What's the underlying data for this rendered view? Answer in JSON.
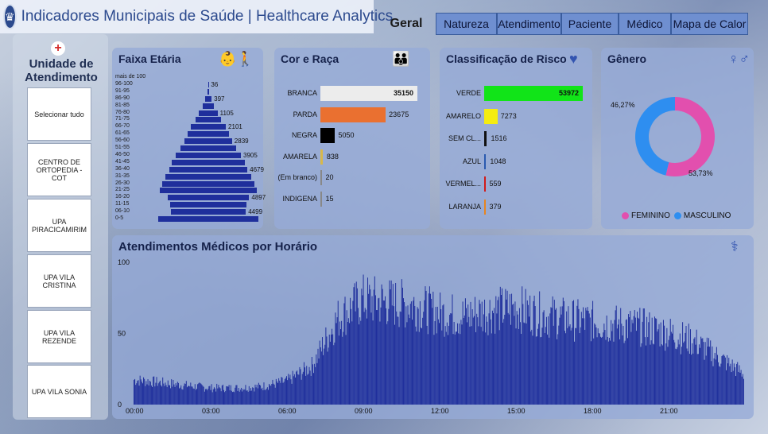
{
  "header": {
    "title": "Indicadores Municipais de Saúde | Healthcare Analytics",
    "active_tab": "Geral",
    "tabs": [
      "Natureza",
      "Atendimento",
      "Paciente",
      "Médico",
      "Mapa de Calor"
    ]
  },
  "left_panel": {
    "title": "Unidade de Atendimento",
    "items": [
      "Selecionar tudo",
      "CENTRO DE ORTOPEDIA - COT",
      "UPA PIRACICAMIRIM",
      "UPA VILA CRISTINA",
      "UPA VILA REZENDE",
      "UPA VILA SONIA"
    ]
  },
  "icons": {
    "logo": "city-crest-icon",
    "unit": "red-cross-icon",
    "age": "baby-elder-icon",
    "race": "people-group-icon",
    "risk": "heart-pulse-icon",
    "gender": "male-female-icon",
    "hourly": "stethoscope-icon"
  },
  "colors": {
    "accent": "#1f2f9c",
    "female": "#e24fae",
    "male": "#2e8ef0"
  },
  "chart_data": [
    {
      "type": "bar",
      "title": "Faixa Etária",
      "categories": [
        "mais de 100",
        "96-100",
        "91-95",
        "86-90",
        "81-85",
        "76-80",
        "71-75",
        "66-70",
        "61-65",
        "56-60",
        "51-55",
        "46-50",
        "41-45",
        "36-40",
        "31-35",
        "26-30",
        "21-25",
        "16-20",
        "11-15",
        "06-10",
        "0-5"
      ],
      "values": [
        0,
        36,
        120,
        397,
        700,
        1105,
        1500,
        2101,
        2500,
        2839,
        3300,
        3905,
        4400,
        4679,
        5100,
        5500,
        5800,
        4897,
        4600,
        4499,
        6000
      ],
      "data_labels": [
        "",
        "36",
        "",
        "397",
        "",
        "1105",
        "",
        "2101",
        "",
        "2839",
        "",
        "3905",
        "",
        "4679",
        "",
        "",
        "",
        "4897",
        "",
        "4499",
        ""
      ]
    },
    {
      "type": "bar",
      "title": "Cor e Raça",
      "categories": [
        "BRANCA",
        "PARDA",
        "NEGRA",
        "AMARELA",
        "(Em branco)",
        "INDIGENA"
      ],
      "values": [
        35150,
        23675,
        5050,
        838,
        20,
        15
      ],
      "colors": [
        "#ececec",
        "#ea7030",
        "#000000",
        "#d8b84a",
        "#888888",
        "#888888"
      ]
    },
    {
      "type": "bar",
      "title": "Classificação de Risco",
      "categories": [
        "VERDE",
        "AMARELO",
        "SEM CL...",
        "AZUL",
        "VERMEL...",
        "LARANJA"
      ],
      "values": [
        53972,
        7273,
        1516,
        1048,
        559,
        379
      ],
      "colors": [
        "#11e418",
        "#f4ec10",
        "#111111",
        "#2a5ab0",
        "#d11a1a",
        "#e8851e"
      ]
    },
    {
      "type": "pie",
      "title": "Gênero",
      "categories": [
        "FEMININO",
        "MASCULINO"
      ],
      "values": [
        53.73,
        46.27
      ],
      "labels": [
        "53,73%",
        "46,27%"
      ]
    },
    {
      "type": "bar",
      "title": "Atendimentos Médicos por Horário",
      "x_ticks": [
        "00:00",
        "03:00",
        "06:00",
        "09:00",
        "12:00",
        "15:00",
        "18:00",
        "21:00"
      ],
      "y_ticks": [
        "0",
        "50",
        "100"
      ],
      "ylim": [
        0,
        100
      ],
      "profile_hours": [
        0,
        1,
        2,
        3,
        4,
        5,
        6,
        7,
        8,
        9,
        10,
        11,
        12,
        13,
        14,
        15,
        16,
        17,
        18,
        19,
        20,
        21,
        22,
        23,
        24
      ],
      "profile_values": [
        18,
        16,
        14,
        12,
        12,
        13,
        17,
        28,
        62,
        76,
        74,
        72,
        66,
        64,
        68,
        70,
        65,
        62,
        60,
        58,
        56,
        52,
        46,
        34,
        22
      ]
    }
  ]
}
